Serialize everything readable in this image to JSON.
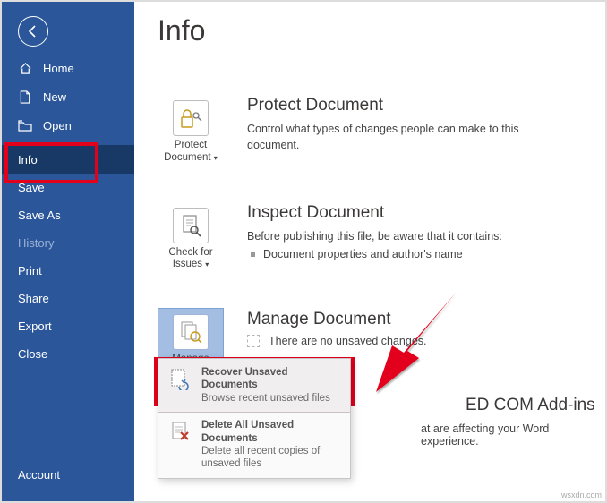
{
  "sidebar": {
    "items": [
      {
        "label": "Home"
      },
      {
        "label": "New"
      },
      {
        "label": "Open"
      },
      {
        "label": "Info"
      },
      {
        "label": "Save"
      },
      {
        "label": "Save As"
      },
      {
        "label": "History"
      },
      {
        "label": "Print"
      },
      {
        "label": "Share"
      },
      {
        "label": "Export"
      },
      {
        "label": "Close"
      }
    ],
    "account_label": "Account"
  },
  "page": {
    "title": "Info"
  },
  "protect": {
    "tile_label": "Protect Document",
    "title": "Protect Document",
    "desc": "Control what types of changes people can make to this document."
  },
  "inspect": {
    "tile_label": "Check for Issues",
    "title": "Inspect Document",
    "desc": "Before publishing this file, be aware that it contains:",
    "bullet1": "Document properties and author's name"
  },
  "manage": {
    "tile_label": "Manage Document",
    "title": "Manage Document",
    "none_text": "There are no unsaved changes."
  },
  "dropdown": {
    "recover": {
      "title": "Recover Unsaved Documents",
      "desc": "Browse recent unsaved files"
    },
    "delete": {
      "title": "Delete All Unsaved Documents",
      "desc": "Delete all recent copies of unsaved files"
    }
  },
  "addins": {
    "title_fragment": "ED COM Add-ins",
    "desc_fragment": "at are affecting your Word experience."
  },
  "watermark": "wsxdn.com"
}
